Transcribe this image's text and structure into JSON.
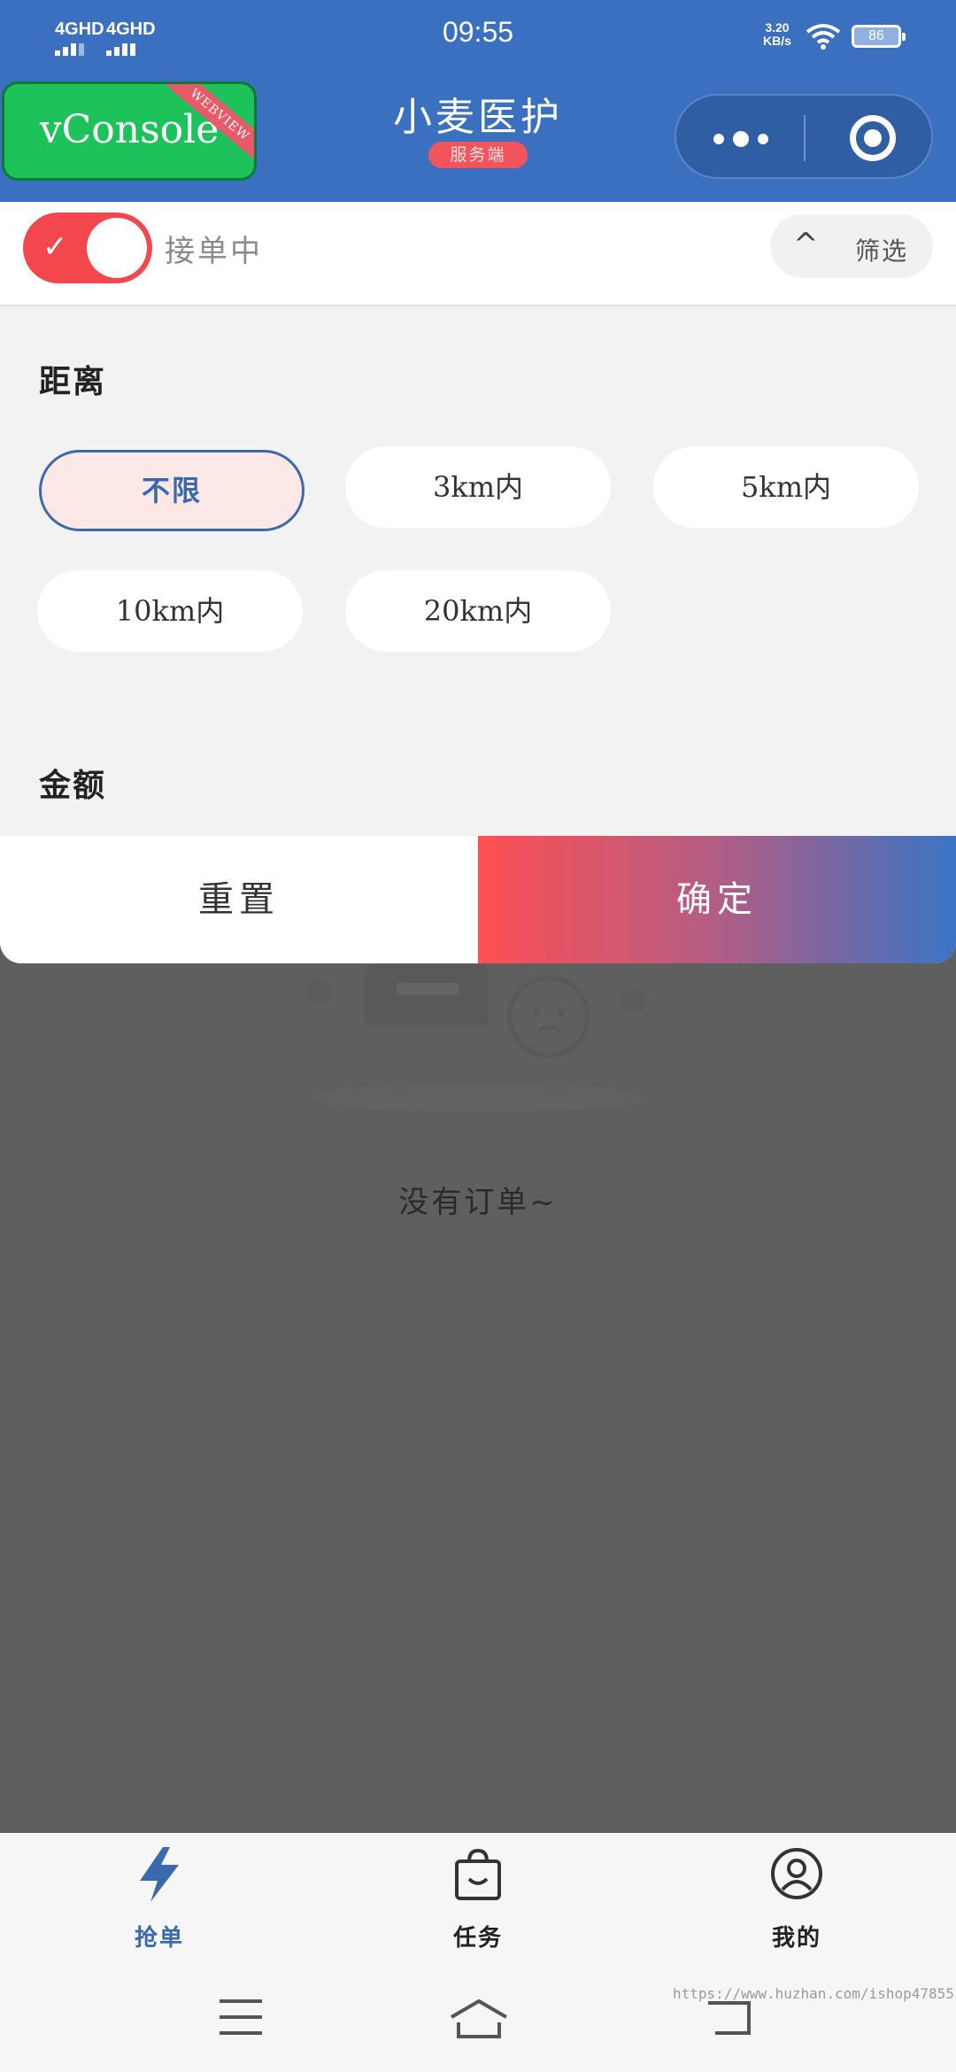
{
  "status_bar": {
    "signal_1": "4GHD",
    "signal_2": "4GHD",
    "time": "09:55",
    "net_speed_value": "3.20",
    "net_speed_unit": "KB/s",
    "battery": "86"
  },
  "header": {
    "vconsole_label": "vConsole",
    "vconsole_ribbon": "WEBVIEW",
    "title": "小麦医护",
    "badge": "服务端",
    "menu_icon": "more-dots-icon",
    "close_icon": "target-circle-icon"
  },
  "toolbar": {
    "toggle_on": true,
    "toggle_label": "接单中",
    "filter_chevron": "^",
    "filter_label": "筛选"
  },
  "filter": {
    "distance": {
      "title": "距离",
      "options": [
        "不限",
        "3km内",
        "5km内",
        "10km内",
        "20km内"
      ],
      "selected_index": 0
    },
    "amount": {
      "title": "金额"
    },
    "reset_label": "重置",
    "confirm_label": "确定"
  },
  "empty_state": {
    "text": "没有订单~"
  },
  "tabbar": {
    "tabs": [
      {
        "label": "抢单",
        "icon": "lightning-icon",
        "active": true
      },
      {
        "label": "任务",
        "icon": "shopping-bag-icon",
        "active": false
      },
      {
        "label": "我的",
        "icon": "user-circle-icon",
        "active": false
      }
    ]
  },
  "system_nav": {
    "icons": [
      "menu-icon",
      "home-icon",
      "back-icon"
    ]
  },
  "watermark": "https://www.huzhan.com/ishop47855",
  "colors": {
    "primary_blue": "#3a70bf",
    "accent_red": "#f2474d",
    "vconsole_green": "#1ec25a"
  }
}
